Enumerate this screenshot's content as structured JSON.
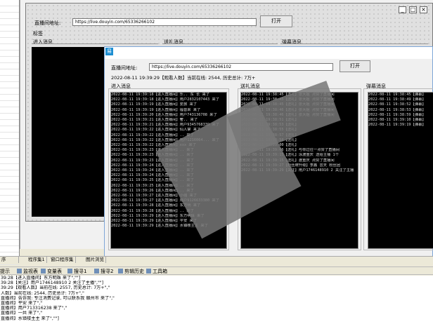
{
  "designer": {
    "url_label": "直播间地址:",
    "url_value": "https://live.douyin.com/65336266102",
    "open_button": "打开",
    "label_text": "标签",
    "groups": [
      "进入消息",
      "送礼消息",
      "弹幕消息"
    ],
    "window_buttons": [
      "_",
      "□",
      "×"
    ]
  },
  "preview": {
    "url_label": "直播间地址:",
    "url_value": "https://live.douyin.com/65336266102",
    "open_button": "打开",
    "stats": "2022-08-11 19:39:29【观看人数】当前在线: 2544, 历史总计: 7万+",
    "groups": [
      "进入消息",
      "送礼消息",
      "弹幕消息"
    ],
    "enter_lines": [
      "2022-08-11 19:39:18【进入直播间】乐.. 东 长 来了",
      "2022-08-11 19:39:18【进入直播间】用户2832107443 来了",
      "2022-08-11 19:39:19【进入直播间】爱旅 来了",
      "2022-08-11 19:39:19【进入直播间】福音来 来了",
      "2022-08-11 19:39:20【进入直播间】用户743136708 来了",
      "2022-08-11 19:39:21【进入直播间】奢.. 来了",
      "2022-08-11 19:39:21【进入直播间】用户9345768339 来了",
      "2022-08-11 19:39:22【进入直播间】仙人掌 来了",
      "2022-08-11 19:39:22【进入直播间】.. 来了",
      "2022-08-11 19:39:22【进入直播间】用户1216064... 来了",
      "2022-08-11 19:39:22【进入直播间】xxx 来了",
      "2022-08-11 19:39:23【进入直播间】.. 来了",
      "2022-08-11 19:39:23【进入直播间】.. 来了",
      "2022-08-11 19:39:23【进入直播间】.. 来了",
      "2022-08-11 19:39:24【进入直播间】.. 来了",
      "2022-08-11 19:39:24【进入直播间】.. 来了",
      "2022-08-11 19:39:24【进入直播间】.. 来了",
      "2022-08-11 19:39:25【进入直播间】.. 来了",
      "2022-08-11 19:39:25【进入直播间】.. 来了",
      "2022-08-11 19:39:26【进入直播间】.. 来了",
      "2022-08-11 19:39:27【进入直播间】小强 来了",
      "2022-08-11 19:39:27【进入直播间】用户9126633380 来了",
      "2022-08-11 19:39:28【进入直播间】东方明 来了",
      "2022-08-11 19:39:28【进入直播间】.. 来了",
      "2022-08-11 19:39:29【进入直播间】东方明珠 来了",
      "2022-08-11 19:39:29【进入直播间】平安 来了",
      "2022-08-11 19:39:29【进入直播间】水镇楼主主 来了"
    ],
    "gift_lines": [
      "2022-08-11 19:38:45【送礼】张大姐 点赞了直播间",
      "2022-08-11 19:38:45【送礼】张大姐 点赞了直播间",
      "2022-08-11 19:38:45【送礼】张大姐 点赞了直播间",
      "2022-08-11 19:38:46【送礼】张大姐 点赞了直播间",
      "2022-08-11 19:38:46【送礼】张大姐 点赞了直播间",
      "2022-08-11 19:38:51【送礼】",
      "2022-08-11 19:38:53【送礼】",
      "2022-08-11 19:38:55【送礼】",
      "2022-08-11 19:38:57【送礼】",
      "2022-08-11 19:38:58【送礼】",
      "2022-08-11 19:39:00【送礼】",
      "2022-08-11 19:39:06【送礼】与你过往一点赞了直播间",
      "2022-08-11 19:39:15【送礼】泳渡重庆 送给主播 1个",
      "2022-08-11 19:39:15【送礼】渡重庆 点赞了直播间",
      "2022-08-11 19:39:27【粉丝牌升级】李鑫 芸天 粉丝团",
      "2022-08-11 19:39:29【关注】用户1746148910 2 关注了主播"
    ],
    "chat_lines": [
      "2022-08-11 19:38:45【弹幕】",
      "2022-08-11 19:38:49【弹幕】",
      "2022-08-11 19:38:52【弹幕】",
      "2022-08-11 19:38:53【弹幕】",
      "2022-08-11 19:38:59【弹幕】",
      "2022-08-11 19:39:10【弹幕】",
      "2022-08-11 19:39:19【弹幕】"
    ]
  },
  "bottom": {
    "doc_tabs": [
      "程序集1",
      "窗口程序集",
      "图片浏览"
    ],
    "panel_tabs": [
      "提示",
      "监视表",
      "变量表",
      "搜寻1",
      "搜寻2",
      "剪辑历史",
      "工具箱"
    ],
    "left_prefix": "序",
    "output_lines": [
      "39:28【进入直播间】东方明珠 来了\",\"\"]",
      "",
      "39:28【关注】用户1746148910 2 关注了主播\",\"\"]",
      "",
      "39:29【观看人数】当前在线: 2557, 历史总计: 7万+\",\"",
      "人数】当前在线: 2544, 历史总计: 7万+\",\"",
      "直播间】告诉我: 专注消费记录, 可以联系我 赣州市 来了\",\"",
      "直播间】平安 来了\",\"",
      "直播间】用户713316238 来了\",\"",
      "直播间】一共 来了\",\"",
      "直播间】水镇楼主主 来了\",\"\"]"
    ]
  },
  "colors": {
    "accent": "#1d8ed1",
    "console_bg": "#000000",
    "console_fg": "#d8d8d8"
  }
}
